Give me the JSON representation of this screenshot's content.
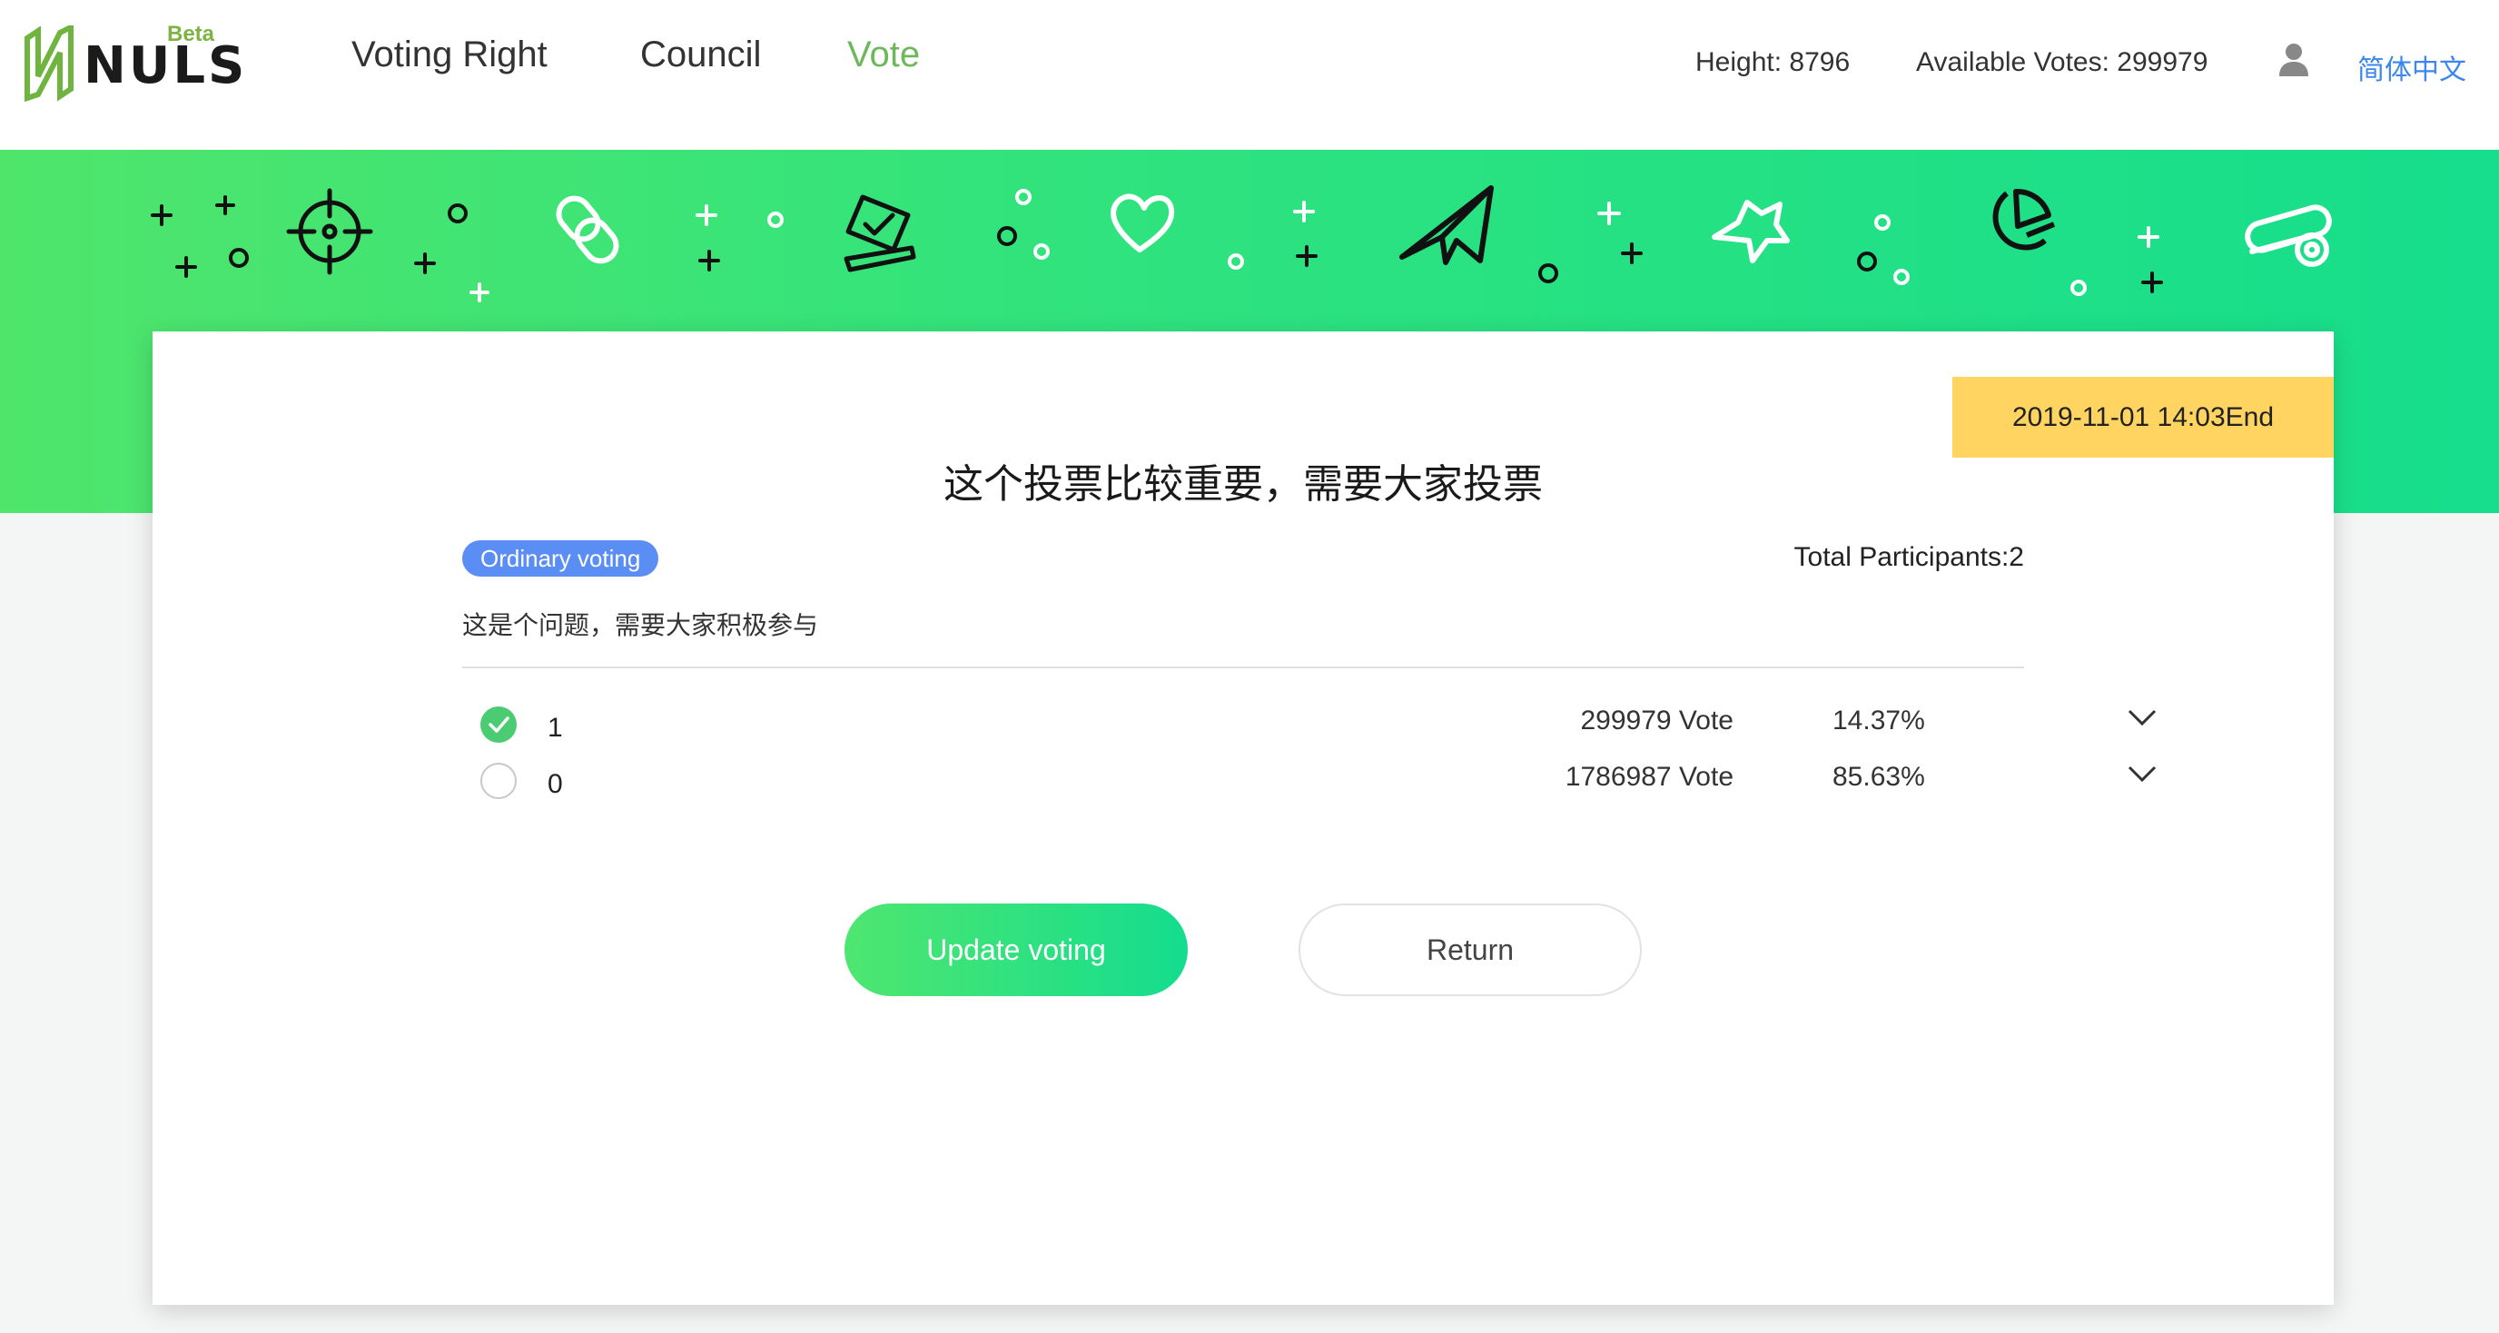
{
  "header": {
    "logo_text": "NULS",
    "logo_badge": "Beta",
    "nav": [
      {
        "label": "Voting Right",
        "active": false
      },
      {
        "label": "Council",
        "active": false
      },
      {
        "label": "Vote",
        "active": true
      }
    ],
    "height_label": "Height: 8796",
    "available_votes_label": "Available Votes: 299979",
    "user_icon": "user-icon",
    "language": "简体中文"
  },
  "banner": {
    "icons": [
      "crosshair-icon",
      "link-icon",
      "ballot-box-icon",
      "heart-icon",
      "paper-plane-icon",
      "star-icon",
      "pie-chart-icon",
      "coin-stack-icon"
    ],
    "gradient": [
      "#4fe56b",
      "#16de8c"
    ]
  },
  "proposal": {
    "end_time": "2019-11-01 14:03End",
    "title": "这个投票比较重要，需要大家投票",
    "type": "Ordinary voting",
    "total_participants": "Total Participants:2",
    "description": "这是个问题，需要大家积极参与",
    "options": [
      {
        "label": "1",
        "votes": "299979 Vote",
        "percent": "14.37%",
        "checked": true
      },
      {
        "label": "0",
        "votes": "1786987 Vote",
        "percent": "85.63%",
        "checked": false
      }
    ],
    "update_button": "Update voting",
    "return_button": "Return"
  },
  "colors": {
    "accent_green": "#4ccc72",
    "nav_active": "#6db85a",
    "link_blue": "#3b86f0",
    "badge_blue": "#5b8ef5",
    "end_badge": "#ffd460"
  }
}
